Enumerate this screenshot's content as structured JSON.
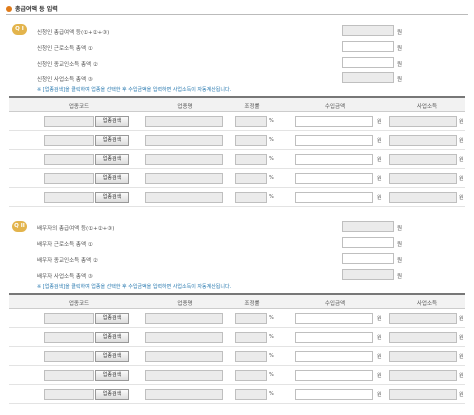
{
  "header": {
    "title": "총급여액 등 입력"
  },
  "q1": {
    "badge": "Q I",
    "rows": [
      {
        "label": "신청인 총급여액 등(①+②+③)",
        "unit": "원"
      },
      {
        "label": "신청인 근로소득 총액 ①",
        "unit": "원"
      },
      {
        "label": "신청인 종교인소득 총액 ②",
        "unit": "원"
      },
      {
        "label": "신청인 사업소득 총액 ③",
        "unit": "원"
      }
    ],
    "note": "※ [업종검색]을 클릭하여 업종을 선택한 후 수입금액을 입력하면 사업소득이 자동계산됩니다."
  },
  "q2": {
    "badge": "Q II",
    "rows": [
      {
        "label": "배우자의 총급여액 등(①+②+③)",
        "unit": "원"
      },
      {
        "label": "배우자 근로소득 총액 ①",
        "unit": "원"
      },
      {
        "label": "배우자 종교인소득 총액 ②",
        "unit": "원"
      },
      {
        "label": "배우자 사업소득 총액 ③",
        "unit": "원"
      }
    ],
    "note": "※ [업종검색]을 클릭하여 업종을 선택한 후 수입금액을 입력하면 사업소득이 자동계산됩니다."
  },
  "table": {
    "headers": [
      "업종코드",
      "업종명",
      "조정률",
      "수입금액",
      "사업소득"
    ],
    "search_button": "업종검색",
    "pct_unit": "%",
    "won_unit": "원"
  }
}
